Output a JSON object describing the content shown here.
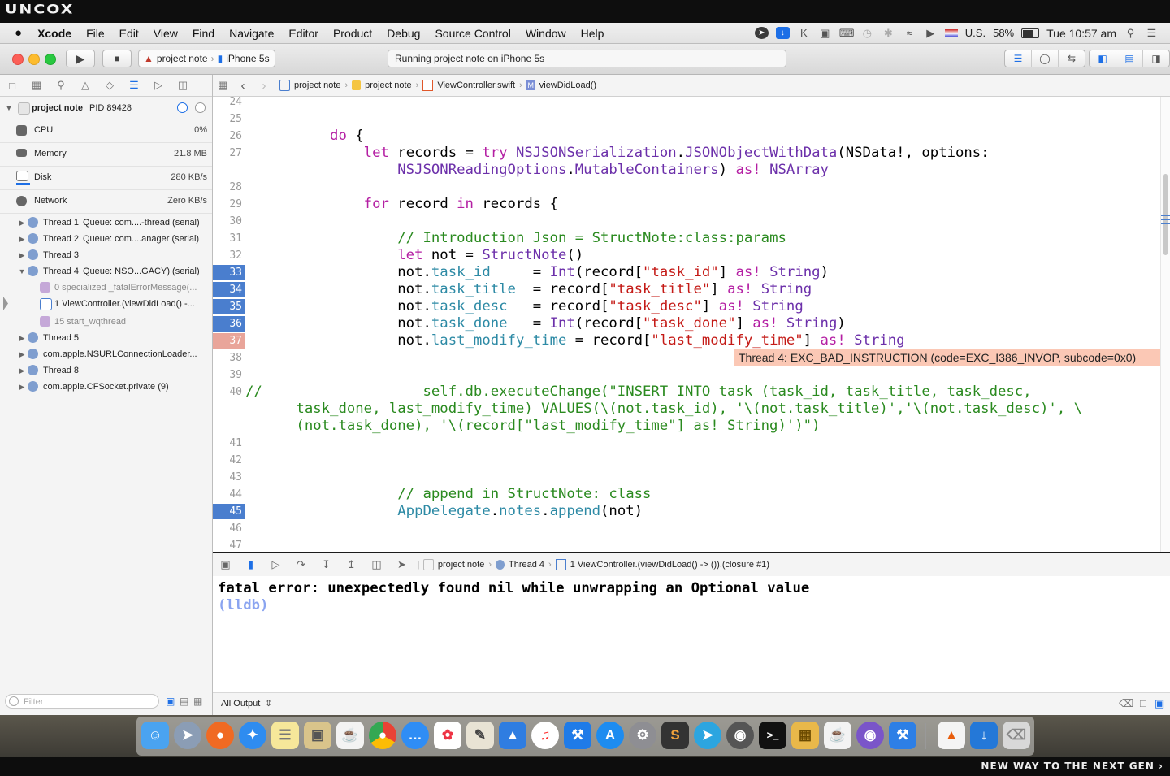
{
  "banner": {
    "logo": "UNCOX",
    "tagline": "NEW WAY TO THE NEXT GEN ›"
  },
  "menubar": {
    "apple": "",
    "app": "Xcode",
    "items": [
      "File",
      "Edit",
      "View",
      "Find",
      "Navigate",
      "Editor",
      "Product",
      "Debug",
      "Source Control",
      "Window",
      "Help"
    ],
    "status": {
      "input_source": "U.S.",
      "battery": "58%",
      "clock": "Tue 10:57 am"
    }
  },
  "toolbar": {
    "scheme": "project note",
    "device": "iPhone 5s",
    "activity": "Running project note on iPhone 5s"
  },
  "navigator": {
    "process": {
      "name": "project note",
      "pid": "PID 89428"
    },
    "gauges": [
      {
        "label": "CPU",
        "value": "0%"
      },
      {
        "label": "Memory",
        "value": "21.8 MB"
      },
      {
        "label": "Disk",
        "value": "280 KB/s"
      },
      {
        "label": "Network",
        "value": "Zero KB/s"
      }
    ],
    "threads": [
      {
        "name": "Thread 1",
        "queue": "Queue: com....-thread (serial)"
      },
      {
        "name": "Thread 2",
        "queue": "Queue: com....anager (serial)"
      },
      {
        "name": "Thread 3",
        "queue": ""
      },
      {
        "name": "Thread 4",
        "queue": "Queue: NSO...GACY) (serial)"
      }
    ],
    "frames": [
      "0 specialized _fatalErrorMessage(...",
      "1 ViewController.(viewDidLoad() -...",
      "15 start_wqthread"
    ],
    "threads_after": [
      {
        "name": "Thread 5"
      },
      {
        "name": "com.apple.NSURLConnectionLoader..."
      },
      {
        "name": "Thread 8"
      },
      {
        "name": "com.apple.CFSocket.private (9)"
      }
    ],
    "filter_placeholder": "Filter"
  },
  "jumpbar": {
    "crumbs": [
      "project note",
      "project note",
      "ViewController.swift",
      "viewDidLoad()"
    ]
  },
  "editor": {
    "line_numbers": [
      "24",
      "25",
      "26",
      "27",
      "",
      "28",
      "29",
      "30",
      "31",
      "32",
      "33",
      "34",
      "35",
      "36",
      "37",
      "38",
      "39",
      "40",
      "",
      "",
      "41",
      "42",
      "43",
      "44",
      "45",
      "46",
      "47"
    ],
    "breakpoint_lines": [
      "33",
      "34",
      "35",
      "36",
      "37",
      "45"
    ],
    "error_message": "Thread 4: EXC_BAD_INSTRUCTION (code=EXC_I386_INVOP, subcode=0x0)"
  },
  "debugbar": {
    "crumbs": [
      "project note",
      "Thread 4",
      "1 ViewController.(viewDidLoad() -> ()).(closure #1)"
    ]
  },
  "console": {
    "error": "fatal error: unexpectedly found nil while unwrapping an Optional value",
    "prompt": "(lldb)",
    "output_selector": "All Output"
  }
}
